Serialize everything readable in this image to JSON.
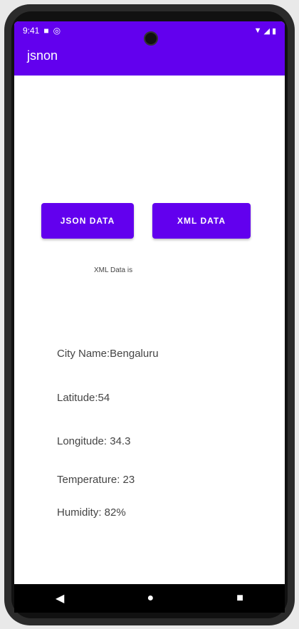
{
  "status": {
    "time": "9:41"
  },
  "app": {
    "title": "jsnon"
  },
  "buttons": {
    "json": "JSON DATA",
    "xml": "XML DATA"
  },
  "xml_label": "XML Data is",
  "fields": {
    "city": "City Name:Bengaluru",
    "latitude": "Latitude:54",
    "longitude": "Longitude: 34.3",
    "temperature": "Temperature: 23",
    "humidity": "Humidity: 82%"
  },
  "colors": {
    "primary": "#6200ee"
  },
  "icons": {
    "back": "back-icon",
    "home": "home-icon",
    "recents": "recents-icon"
  }
}
